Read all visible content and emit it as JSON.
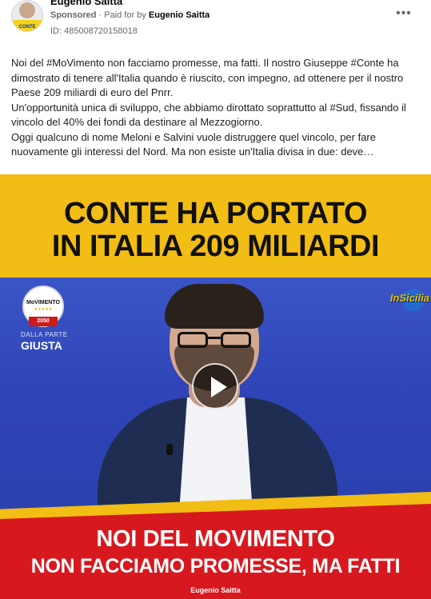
{
  "header": {
    "page_name": "Eugenio Saitta",
    "sponsored_label": "Sponsored",
    "separator": " · ",
    "paid_for_label": "Paid for by",
    "payer": "Eugenio Saitta",
    "ad_id": "ID: 485008720158018",
    "more_icon": "more-dots-icon",
    "avatar_band_text": "CONTE"
  },
  "post": {
    "paragraphs": [
      "Noi del #MoVimento non facciamo promesse, ma fatti. Il nostro Giuseppe #Conte ha dimostrato di tenere all'Italia quando è riuscito, con impegno, ad ottenere per il nostro Paese 209 miliardi di euro del Pnrr.",
      "Un'opportunità unica di sviluppo, che abbiamo dirottato soprattutto al #Sud, fissando il vincolo del 40% dei fondi da destinare al Mezzogiorno.",
      "Oggi qualcuno di nome Meloni e Salvini vuole distruggere quel vincolo, per fare nuovamente gli interessi del Nord. Ma non esiste un'Italia divisa in due: deve…"
    ]
  },
  "media": {
    "headline_line1": "CONTE HA PORTATO",
    "headline_line2": "IN ITALIA 209 MILIARDI",
    "logo_label": "MoVIMENTO",
    "logo_stars": "★★★★★",
    "logo_year": "2050",
    "dalla_parte": "DALLA PARTE",
    "giusta": "GIUSTA",
    "channel_logo": "InSicilia",
    "caption_line1": "NOI DEL MOVIMENTO",
    "caption_line2": "NON FACCIAMO PROMESSE, MA FATTI",
    "caption_name": "Eugenio Saitta",
    "play_icon": "play-icon"
  }
}
